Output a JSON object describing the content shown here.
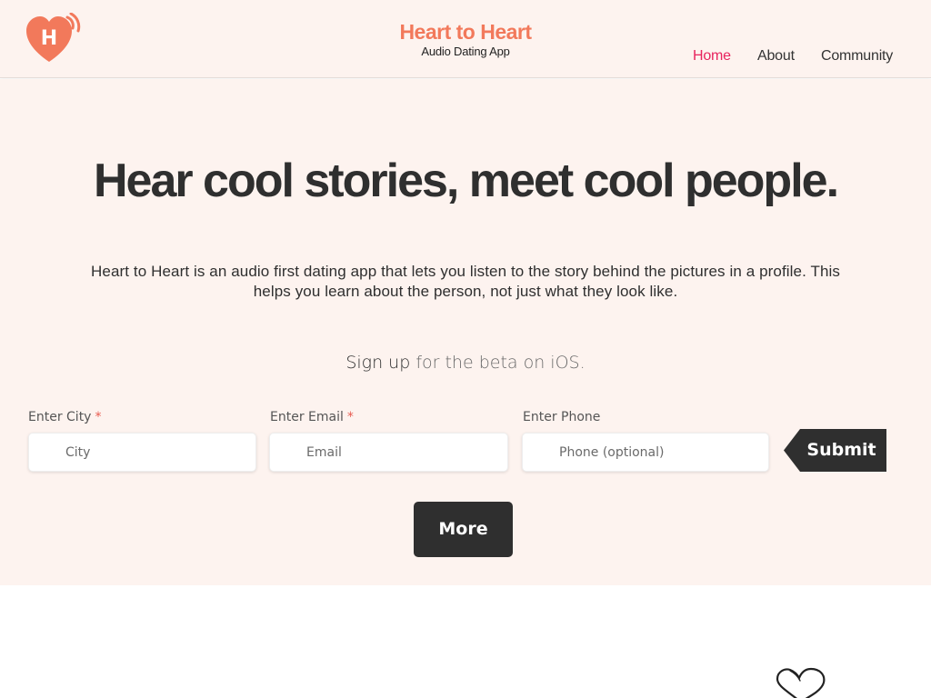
{
  "header": {
    "logo_letter": "H",
    "title": "Heart to Heart",
    "subtitle": "Audio Dating App",
    "nav": [
      {
        "label": "Home",
        "active": true
      },
      {
        "label": "About",
        "active": false
      },
      {
        "label": "Community",
        "active": false
      }
    ]
  },
  "hero": {
    "headline": "Hear cool stories, meet cool people.",
    "description": "Heart to Heart is an audio first dating app that lets you listen to the story behind the pictures in a profile. This helps you learn about the person, not just what they look like.",
    "signup_strong": "Sign up",
    "signup_rest": " for the beta on iOS."
  },
  "form": {
    "city": {
      "label": "Enter City",
      "required_mark": "*",
      "placeholder": "City"
    },
    "email": {
      "label": "Enter Email",
      "required_mark": "*",
      "placeholder": "Email"
    },
    "phone": {
      "label": "Enter Phone",
      "placeholder": "Phone (optional)"
    },
    "submit_label": "Submit",
    "more_label": "More"
  },
  "icons": {
    "logo": "heart-sound-logo-icon",
    "doodle": "heart-doodle-icon"
  },
  "colors": {
    "brand": "#f2795b",
    "nav_active": "#e8245e",
    "background": "#fdf3ef",
    "button": "#2f2f2f",
    "required": "#e85a4f"
  }
}
